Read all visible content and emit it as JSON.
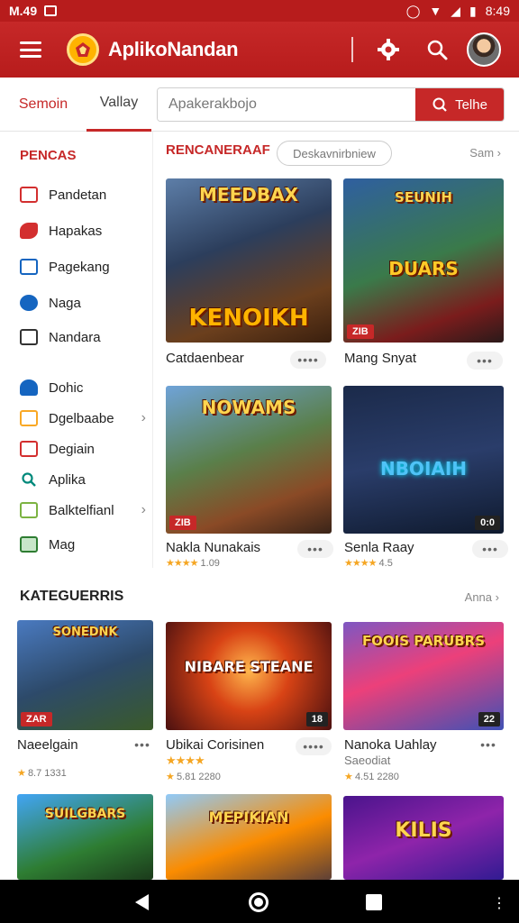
{
  "status_bar": {
    "left_text": "M.49",
    "time": "8:49"
  },
  "app": {
    "title": "AplikoNandan"
  },
  "tabs": [
    {
      "label": "Semoin"
    },
    {
      "label": "Vallay"
    }
  ],
  "search": {
    "placeholder": "Apakerakbojo",
    "button_label": "Telhe"
  },
  "sidebar": {
    "heading": "PENCAS",
    "items": [
      {
        "label": "Pandetan",
        "icon": "folder-icon",
        "color": "#d32f2f"
      },
      {
        "label": "Hapakas",
        "icon": "puzzle-icon",
        "color": "#d32f2f"
      },
      {
        "label": "Pagekang",
        "icon": "grid-icon",
        "color": "#1565c0"
      },
      {
        "label": "Naga",
        "icon": "shield-icon",
        "color": "#1565c0"
      },
      {
        "label": "Nandara",
        "icon": "tv-icon",
        "color": "#333333"
      },
      {
        "label": "Dohic",
        "icon": "bookmark-icon",
        "color": "#1565c0"
      },
      {
        "label": "Dgelbaabe",
        "icon": "star-icon",
        "color": "#f9a825"
      },
      {
        "label": "Degiain",
        "icon": "gamepad-icon",
        "color": "#d32f2f"
      },
      {
        "label": "Aplika",
        "icon": "search-icon",
        "color": "#00897b"
      },
      {
        "label": "Balktelfianl",
        "icon": "list-icon",
        "color": "#7cb342"
      },
      {
        "label": "Mag",
        "icon": "image-icon",
        "color": "#2e7d32"
      }
    ]
  },
  "featured": {
    "heading": "RENCANERAAF",
    "pill": "Deskavnirbniew",
    "see_all": "Sam",
    "cards": [
      {
        "art_title": "MEEDBAX",
        "art_subtitle": "KENOIKH",
        "tag": "",
        "title": "Catdaenbear",
        "rating": ""
      },
      {
        "art_title": "SEUNIH",
        "art_subtitle": "DUARS",
        "tag": "ZIB",
        "title": "Mang Snyat",
        "rating": ""
      },
      {
        "art_title": "NOWAMS",
        "art_subtitle": "",
        "tag": "ZIB",
        "title": "Nakla Nunakais",
        "rating": "1.09"
      },
      {
        "art_title": "NBOIAIH",
        "art_subtitle": "",
        "tag": "0:0",
        "title": "Senla Raay",
        "rating": "4.5"
      }
    ]
  },
  "categories": {
    "heading": "KATEGUERRIS",
    "see_all": "Anna",
    "cards": [
      {
        "art_title": "SONEDNK",
        "tag": "ZAR",
        "title": "Naeelgain",
        "subtitle": "",
        "rating": "8.7 1331"
      },
      {
        "art_title": "NIBARE STEANE",
        "tag": "18",
        "title": "Ubikai Corisinen",
        "subtitle": "",
        "rating": "5.81 2280"
      },
      {
        "art_title": "FOOIS PARUBRS",
        "tag": "22",
        "title": "Nanoka Uahlay",
        "subtitle": "Saeodiat",
        "rating": "4.51 2280"
      },
      {
        "art_title": "SUILGBARS",
        "tag": "",
        "title": "",
        "subtitle": "",
        "rating": ""
      },
      {
        "art_title": "MEPIKIAN",
        "tag": "",
        "title": "",
        "subtitle": "",
        "rating": ""
      },
      {
        "art_title": "KILIS",
        "tag": "",
        "title": "",
        "subtitle": "",
        "rating": ""
      }
    ]
  },
  "colors": {
    "brand": "#c62828",
    "star": "#f5a623"
  }
}
